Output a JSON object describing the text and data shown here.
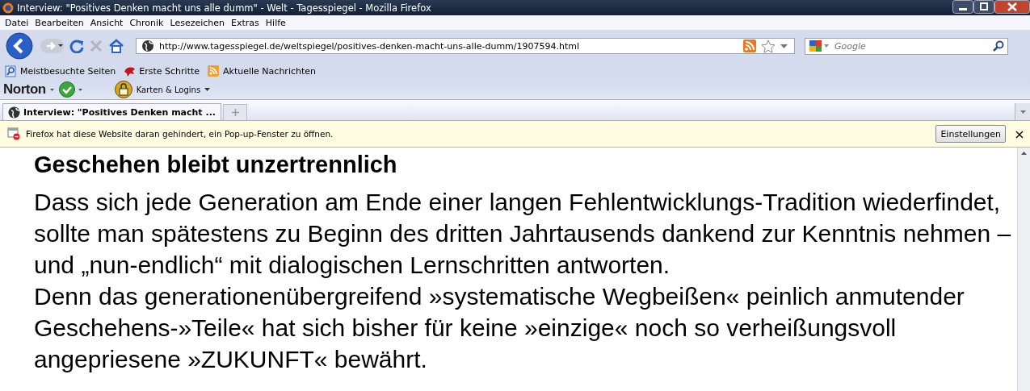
{
  "window": {
    "title": "Interview: \"Positives Denken macht uns alle dumm\" - Welt - Tagesspiegel - Mozilla Firefox"
  },
  "menu": [
    "Datei",
    "Bearbeiten",
    "Ansicht",
    "Chronik",
    "Lesezeichen",
    "Extras",
    "Hilfe"
  ],
  "navigation": {
    "url": "http://www.tagesspiegel.de/weltspiegel/positives-denken-macht-uns-alle-dumm/1907594.html",
    "search_placeholder": "Google"
  },
  "bookmarks": [
    "Meistbesuchte Seiten",
    "Erste Schritte",
    "Aktuelle Nachrichten"
  ],
  "norton": {
    "logo": "Norton",
    "logins": "Karten & Logins"
  },
  "tabs": [
    {
      "label": "Interview: \"Positives Denken macht ...",
      "selected": true
    }
  ],
  "notification": {
    "message": "Firefox hat diese Website daran gehindert, ein Pop-up-Fenster zu öffnen.",
    "button": "Einstellungen",
    "close": "×"
  },
  "article": {
    "heading": "Geschehen bleibt unzertrennlich",
    "paragraphs": [
      "Dass sich jede Generation am Ende einer langen Fehlentwicklungs-Tradition wiederfindet, sollte man spätestens zu Beginn des dritten Jahrtausends dankend zur Kenntnis nehmen – und „nun-endlich“ mit dialogischen Lernschritten antworten.",
      "Denn das generationenübergreifend »systematische Wegbeißen« peinlich anmutender Geschehens-»Teile« hat sich bisher für keine »einzige« noch so verheißungsvoll angepriesene »ZUKUNFT« bewährt."
    ]
  }
}
